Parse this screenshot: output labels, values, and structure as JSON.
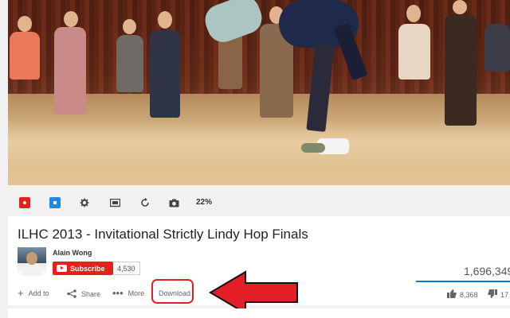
{
  "video": {
    "title": "ILHC 2013 - Invitational Strictly Lindy Hop Finals",
    "progress_percent": 22,
    "progress_label": "22%"
  },
  "channel": {
    "name": "Alain Wong",
    "subscribe_label": "Subscribe",
    "subscriber_count": "4,530"
  },
  "stats": {
    "views": "1,696,349",
    "likes": "8,368",
    "dislikes": "17"
  },
  "actions": {
    "add_to": "Add to",
    "share": "Share",
    "more": "More",
    "download": "Download"
  },
  "controls": [
    {
      "name": "red-extension-icon"
    },
    {
      "name": "blue-extension-icon"
    },
    {
      "name": "gear-icon"
    },
    {
      "name": "screen-icon"
    },
    {
      "name": "loop-icon"
    },
    {
      "name": "camera-icon"
    }
  ],
  "colors": {
    "youtube_red": "#e62117",
    "annotation_red": "#e41e26",
    "link_blue": "#167ac6"
  }
}
